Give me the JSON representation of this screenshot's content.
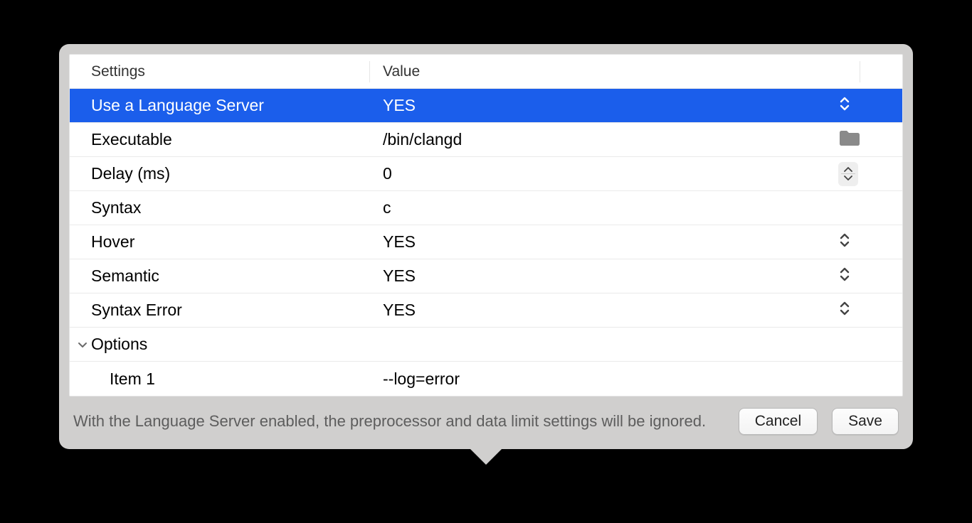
{
  "header": {
    "settings": "Settings",
    "value": "Value"
  },
  "rows": {
    "use_lang_server": {
      "label": "Use a Language Server",
      "value": "YES"
    },
    "executable": {
      "label": "Executable",
      "value": "/bin/clangd"
    },
    "delay": {
      "label": "Delay (ms)",
      "value": "0"
    },
    "syntax": {
      "label": "Syntax",
      "value": "c"
    },
    "hover": {
      "label": "Hover",
      "value": "YES"
    },
    "semantic": {
      "label": "Semantic",
      "value": "YES"
    },
    "syntax_error": {
      "label": "Syntax Error",
      "value": "YES"
    },
    "options": {
      "label": "Options"
    },
    "item1": {
      "label": "Item 1",
      "value": "--log=error"
    }
  },
  "footer": {
    "note": "With the Language Server enabled, the preprocessor and data limit settings will be ignored.",
    "cancel": "Cancel",
    "save": "Save"
  }
}
